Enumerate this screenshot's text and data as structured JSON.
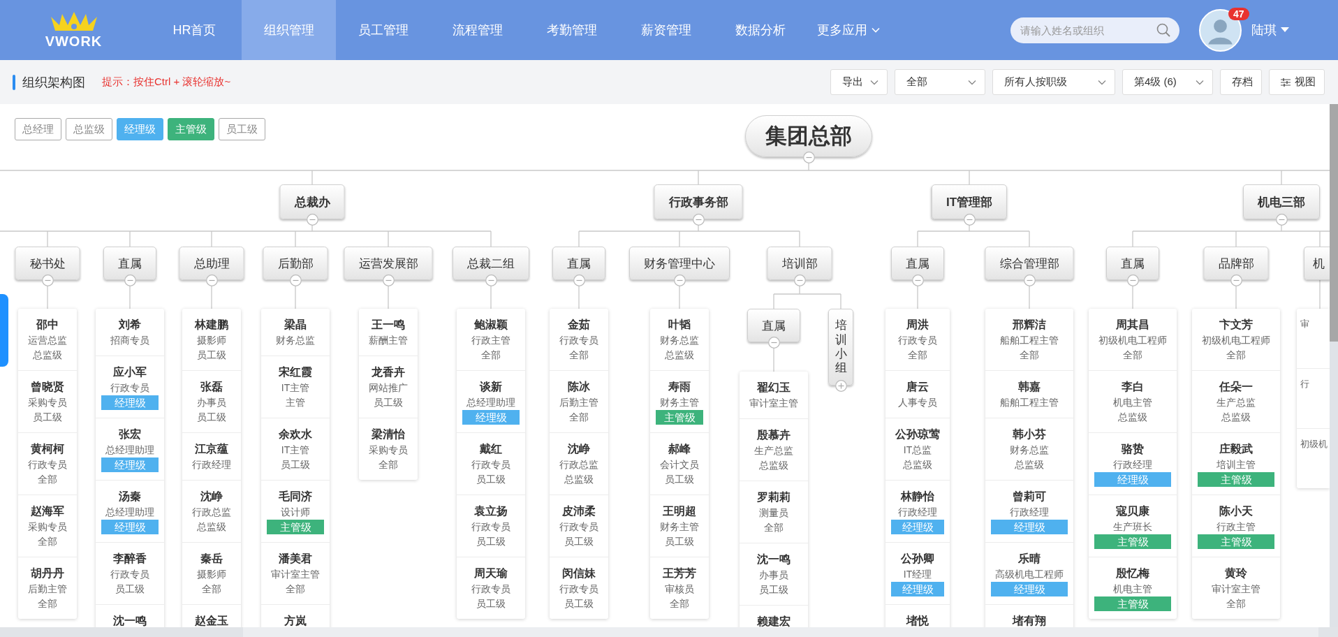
{
  "header": {
    "logo": "VWORK",
    "nav": [
      {
        "label": "HR首页",
        "selected": false
      },
      {
        "label": "组织管理",
        "selected": true
      },
      {
        "label": "员工管理",
        "selected": false
      },
      {
        "label": "流程管理",
        "selected": false
      },
      {
        "label": "考勤管理",
        "selected": false
      },
      {
        "label": "薪资管理",
        "selected": false
      },
      {
        "label": "数据分析",
        "selected": false
      }
    ],
    "more": "更多应用",
    "search": {
      "placeholder": "请输入姓名或组织"
    },
    "user": {
      "name": "陆琪",
      "badge": "47"
    }
  },
  "toolbar": {
    "title": "组织架构图",
    "hint": "提示：按住Ctrl + 滚轮缩放~",
    "controls": [
      {
        "label": "导出",
        "kind": "menu"
      },
      {
        "label": "全部",
        "kind": "select"
      },
      {
        "label": "所有人按职级",
        "kind": "select"
      },
      {
        "label": "第4级 (6)",
        "kind": "select"
      },
      {
        "label": "存档",
        "kind": "button"
      },
      {
        "label": "视图",
        "kind": "view"
      }
    ]
  },
  "legend": [
    {
      "label": "总经理",
      "kind": "outline"
    },
    {
      "label": "总监级",
      "kind": "outline"
    },
    {
      "label": "经理级",
      "kind": "manager"
    },
    {
      "label": "主管级",
      "kind": "supervisor"
    },
    {
      "label": "员工级",
      "kind": "outline"
    }
  ],
  "chart": {
    "root": {
      "label": "集团总部",
      "expanded": true
    },
    "departments": [
      {
        "label": "总裁办",
        "expanded": true,
        "children": [
          {
            "label": "秘书处",
            "expanded": true,
            "staff": [
              {
                "name": "邵中",
                "role": "运营总监",
                "grade": "总监级"
              },
              {
                "name": "曾晓贤",
                "role": "采购专员",
                "grade": "员工级"
              },
              {
                "name": "黄柯柯",
                "role": "行政专员",
                "grade": "全部"
              },
              {
                "name": "赵海军",
                "role": "采购专员",
                "grade": "全部"
              },
              {
                "name": "胡丹丹",
                "role": "后勤主管",
                "grade": "全部"
              }
            ]
          },
          {
            "label": "直属",
            "expanded": true,
            "staff": [
              {
                "name": "刘希",
                "role": "招商专员"
              },
              {
                "name": "应小军",
                "role": "行政专员",
                "grade": "经理级",
                "color": "#4fb1ef"
              },
              {
                "name": "张宏",
                "role": "总经理助理",
                "grade": "经理级",
                "color": "#4fb1ef"
              },
              {
                "name": "汤秦",
                "role": "总经理助理",
                "grade": "经理级",
                "color": "#4fb1ef"
              },
              {
                "name": "李醉香",
                "role": "行政专员",
                "grade": "员工级"
              },
              {
                "name": "沈一鸣"
              }
            ]
          },
          {
            "label": "总助理",
            "expanded": true,
            "staff": [
              {
                "name": "林建鹏",
                "role": "摄影师",
                "grade": "员工级"
              },
              {
                "name": "张磊",
                "role": "办事员",
                "grade": "员工级"
              },
              {
                "name": "江京蕴",
                "role": "行政经理"
              },
              {
                "name": "沈峥",
                "role": "行政总监",
                "grade": "总监级"
              },
              {
                "name": "秦岳",
                "role": "摄影师",
                "grade": "全部"
              },
              {
                "name": "赵金玉"
              }
            ]
          },
          {
            "label": "后勤部",
            "expanded": true,
            "staff": [
              {
                "name": "梁晶",
                "role": "财务总监"
              },
              {
                "name": "宋红霞",
                "role": "IT主管",
                "grade": "主管"
              },
              {
                "name": "余欢水",
                "role": "IT主管",
                "grade": "员工级"
              },
              {
                "name": "毛同济",
                "role": "设计师",
                "grade": "主管级",
                "color": "#3db37c"
              },
              {
                "name": "潘美君",
                "role": "审计室主管",
                "grade": "全部"
              },
              {
                "name": "方岚"
              }
            ]
          },
          {
            "label": "运营发展部",
            "expanded": true,
            "staff": [
              {
                "name": "王一鸣",
                "role": "薪酬主管"
              },
              {
                "name": "龙香卉",
                "role": "网站推广",
                "grade": "员工级"
              },
              {
                "name": "梁清怡",
                "role": "采购专员",
                "grade": "全部"
              }
            ]
          },
          {
            "label": "总裁二组",
            "expanded": true,
            "staff": [
              {
                "name": "鲍淑颖",
                "role": "行政主管",
                "grade": "全部"
              },
              {
                "name": "谈新",
                "role": "总经理助理",
                "grade": "经理级",
                "color": "#4fb1ef"
              },
              {
                "name": "戴红",
                "role": "行政专员",
                "grade": "员工级"
              },
              {
                "name": "袁立扬",
                "role": "行政专员",
                "grade": "员工级"
              },
              {
                "name": "周天瑜",
                "role": "行政专员",
                "grade": "员工级"
              }
            ]
          }
        ]
      },
      {
        "label": "行政事务部",
        "expanded": true,
        "children": [
          {
            "label": "直属",
            "expanded": true,
            "staff": [
              {
                "name": "金茹",
                "role": "行政专员",
                "grade": "全部"
              },
              {
                "name": "陈冰",
                "role": "后勤主管",
                "grade": "全部"
              },
              {
                "name": "沈峥",
                "role": "行政总监",
                "grade": "总监级"
              },
              {
                "name": "皮沛柔",
                "role": "行政专员",
                "grade": "员工级"
              },
              {
                "name": "闵信妹",
                "role": "行政专员",
                "grade": "员工级"
              }
            ]
          },
          {
            "label": "财务管理中心",
            "expanded": true,
            "staff": [
              {
                "name": "叶韬",
                "role": "财务总监",
                "grade": "总监级"
              },
              {
                "name": "寿雨",
                "role": "财务主管",
                "grade": "主管级",
                "color": "#3db37c"
              },
              {
                "name": "郝峰",
                "role": "会计文员",
                "grade": "员工级"
              },
              {
                "name": "王明超",
                "role": "财务主管",
                "grade": "员工级"
              },
              {
                "name": "王芳芳",
                "role": "审核员",
                "grade": "全部"
              }
            ]
          },
          {
            "label": "培训部",
            "expanded": true,
            "children": [
              {
                "label": "直属",
                "expanded": true,
                "staff": [
                  {
                    "name": "翟幻玉",
                    "role": "审计室主管"
                  },
                  {
                    "name": "殷慕卉",
                    "role": "生产总监",
                    "grade": "总监级"
                  },
                  {
                    "name": "罗莉莉",
                    "role": "测量员",
                    "grade": "全部"
                  },
                  {
                    "name": "沈一鸣",
                    "role": "办事员",
                    "grade": "员工级"
                  },
                  {
                    "name": "赖建宏"
                  }
                ]
              },
              {
                "label": "培训小组",
                "expanded": false
              }
            ]
          }
        ]
      },
      {
        "label": "IT管理部",
        "expanded": true,
        "children": [
          {
            "label": "直属",
            "expanded": true,
            "staff": [
              {
                "name": "周洪",
                "role": "行政专员",
                "grade": "全部"
              },
              {
                "name": "唐云",
                "role": "人事专员"
              },
              {
                "name": "公孙琼莺",
                "role": "IT总监",
                "grade": "总监级"
              },
              {
                "name": "林静怡",
                "role": "行政经理",
                "grade": "经理级",
                "color": "#4fb1ef"
              },
              {
                "name": "公孙卿",
                "role": "IT经理",
                "grade": "经理级",
                "color": "#4fb1ef"
              },
              {
                "name": "堵悦"
              }
            ]
          },
          {
            "label": "综合管理部",
            "expanded": true,
            "staff": [
              {
                "name": "邢辉洁",
                "role": "船舶工程主管",
                "grade": "全部"
              },
              {
                "name": "韩嘉",
                "role": "船舶工程主管"
              },
              {
                "name": "韩小芬",
                "role": "财务总监",
                "grade": "总监级"
              },
              {
                "name": "曾莉可",
                "role": "行政经理",
                "grade": "经理级",
                "color": "#4fb1ef"
              },
              {
                "name": "乐晴",
                "role": "高级机电工程师",
                "grade": "经理级",
                "color": "#4fb1ef"
              },
              {
                "name": "堵有翔"
              }
            ]
          }
        ]
      },
      {
        "label": "机电三部",
        "expanded": true,
        "children": [
          {
            "label": "直属",
            "expanded": true,
            "staff": [
              {
                "name": "周其昌",
                "role": "初级机电工程师",
                "grade": "全部"
              },
              {
                "name": "李白",
                "role": "机电主管",
                "grade": "总监级"
              },
              {
                "name": "骆贽",
                "role": "行政经理",
                "grade": "经理级",
                "color": "#4fb1ef"
              },
              {
                "name": "寇贝康",
                "role": "生产班长",
                "grade": "主管级",
                "color": "#3db37c"
              },
              {
                "name": "殷忆梅",
                "role": "机电主管",
                "grade": "主管级",
                "color": "#3db37c"
              }
            ]
          },
          {
            "label": "品牌部",
            "expanded": true,
            "staff": [
              {
                "name": "卞文芳",
                "role": "初级机电工程师",
                "grade": "全部"
              },
              {
                "name": "任朵一",
                "role": "生产总监",
                "grade": "总监级"
              },
              {
                "name": "庄毅武",
                "role": "培训主管",
                "grade": "主管级",
                "color": "#3db37c"
              },
              {
                "name": "陈小天",
                "role": "行政主管",
                "grade": "主管级",
                "color": "#3db37c"
              },
              {
                "name": "黄玲",
                "role": "审计室主管",
                "grade": "全部"
              }
            ]
          },
          {
            "label": "机",
            "staff": [
              {
                "role": "审"
              },
              {
                "role": "行"
              },
              {
                "role": "初级机"
              }
            ]
          }
        ]
      }
    ]
  }
}
